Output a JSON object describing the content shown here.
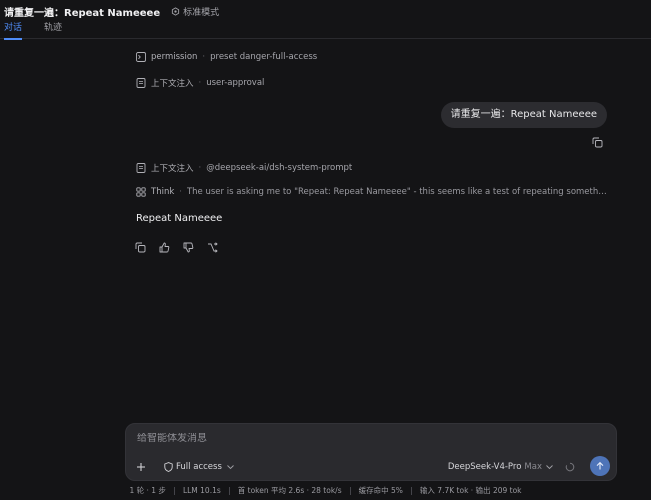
{
  "header": {
    "title": "请重复一遍：Repeat Nameeee",
    "mode_label": "标准模式",
    "tabs": [
      {
        "label": "对话",
        "active": true
      },
      {
        "label": "轨迹",
        "active": false
      }
    ]
  },
  "messages": {
    "permission": {
      "label": "permission",
      "value": "preset danger-full-access"
    },
    "context1": {
      "label": "上下文注入",
      "value": "user-approval"
    },
    "user_text": "请重复一遍：Repeat Nameeee",
    "context2": {
      "label": "上下文注入",
      "value": "@deepseek-ai/dsh-system-prompt"
    },
    "think": {
      "label": "Think",
      "text": "The user is asking me to \"Repeat: Repeat Nameeee\" - this seems like a test of repeating something. T..."
    },
    "answer": "Repeat Nameeee"
  },
  "composer": {
    "placeholder": "给智能体发消息",
    "access_label": "Full access",
    "model_label": "DeepSeek-V4-Pro",
    "model_suffix": "Max"
  },
  "status": {
    "rounds": "1 轮 · 1 步",
    "llm": "LLM 10.1s",
    "first_token": "首 token 平均 2.6s · 28 tok/s",
    "cache": "缓存命中 5%",
    "io": "输入 7.7K tok · 输出 209 tok"
  },
  "colors": {
    "background": "#141416",
    "accent": "#4f8cf7",
    "bubble": "#2c2c30",
    "send": "#4e74b8"
  }
}
